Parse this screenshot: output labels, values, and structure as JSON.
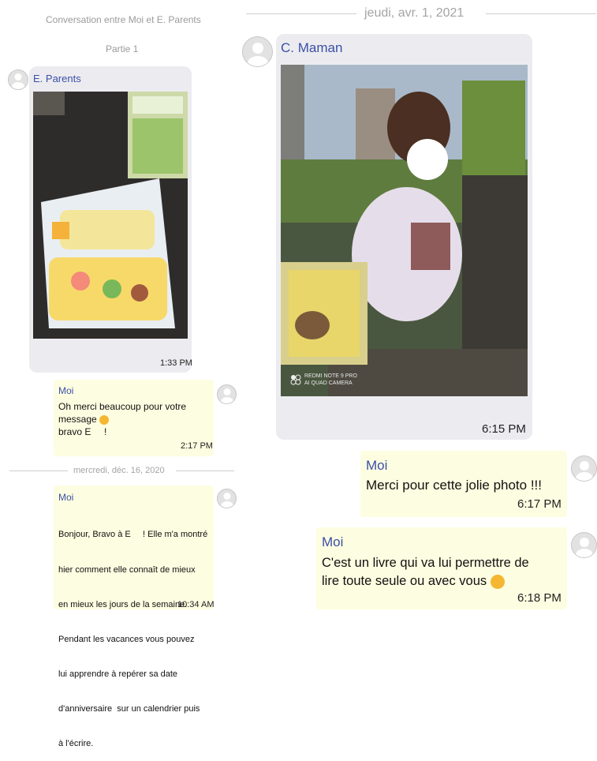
{
  "left_header": {
    "title": "Conversation entre Moi et E. Parents",
    "part": "Partie 1"
  },
  "left_photo_msg": {
    "sender": "E. Parents",
    "time": "1:33 PM",
    "photo_icon": "puzzle-board-photo"
  },
  "left_reply_1": {
    "sender": "Moi",
    "lines": [
      "Oh merci beaucoup pour votre",
      "message",
      "bravo E     !"
    ],
    "time": "2:17 PM"
  },
  "left_date_divider": "mercredi, déc. 16, 2020",
  "left_reply_2": {
    "sender": "Moi",
    "lines": [
      "Bonjour, Bravo à E     ! Elle m'a montré",
      "hier comment elle connaît de mieux",
      "en mieux les jours de la semaine.",
      "Pendant les vacances vous pouvez",
      "lui apprendre à repérer sa date",
      "d'anniversaire  sur un calendrier puis",
      "à l'écrire."
    ],
    "time": "10:34 AM"
  },
  "right_date_divider": "jeudi, avr. 1, 2021",
  "right_photo_msg": {
    "sender": "C. Maman",
    "time": "6:15 PM",
    "camera_watermark_line1": "REDMI NOTE 9 PRO",
    "camera_watermark_line2": "AI QUAD CAMERA"
  },
  "right_reply_1": {
    "sender": "Moi",
    "text": "Merci pour cette jolie photo !!!",
    "time": "6:17 PM"
  },
  "right_reply_2": {
    "sender": "Moi",
    "lines": [
      "C'est un livre qui va lui permettre de",
      "lire toute seule ou avec vous"
    ],
    "time": "6:18 PM"
  },
  "colors": {
    "sender_blue": "#3b4fa8",
    "grey_bubble": "#ececf0",
    "yellow_bubble": "#fdfde1"
  }
}
